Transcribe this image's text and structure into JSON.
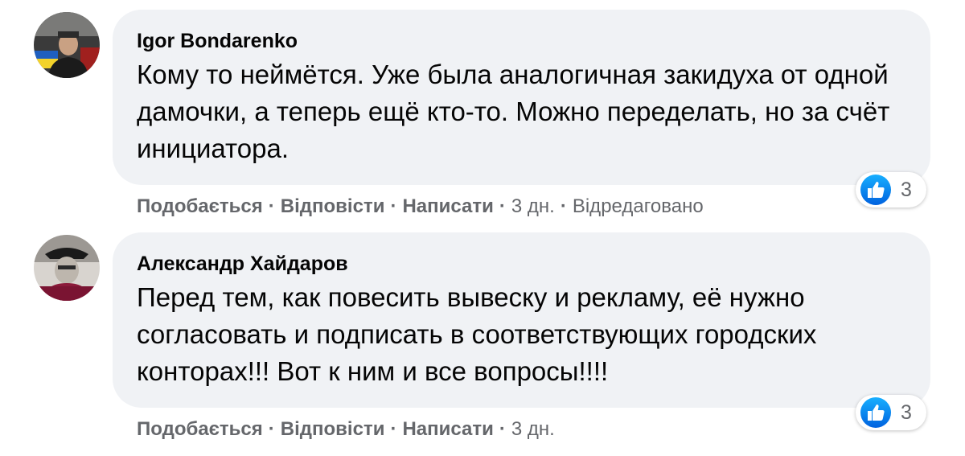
{
  "colors": {
    "bubble_bg": "#f0f2f5",
    "like_blue": "#1877f2",
    "meta_text": "#65676b",
    "text": "#050505"
  },
  "comments": [
    {
      "author": "Igor Bondarenko",
      "text": "Кому то неймётся. Уже была аналогичная закидуха от одной дамочки, а теперь ещё кто-то. Можно переделать, но за счёт инициатора.",
      "reaction_icon": "like-icon",
      "reaction_count": "3",
      "actions": {
        "like": "Подобається",
        "reply": "Відповісти",
        "write": "Написати",
        "time": "3 дн.",
        "edited": "Відредаговано"
      }
    },
    {
      "author": "Александр Хайдаров",
      "text": "Перед тем, как повесить вывеску и рекламу, её нужно согласовать и подписать в соответствующих городских конторах!!! Вот к ним и все вопросы!!!!",
      "reaction_icon": "like-icon",
      "reaction_count": "3",
      "actions": {
        "like": "Подобається",
        "reply": "Відповісти",
        "write": "Написати",
        "time": "3 дн."
      }
    }
  ]
}
